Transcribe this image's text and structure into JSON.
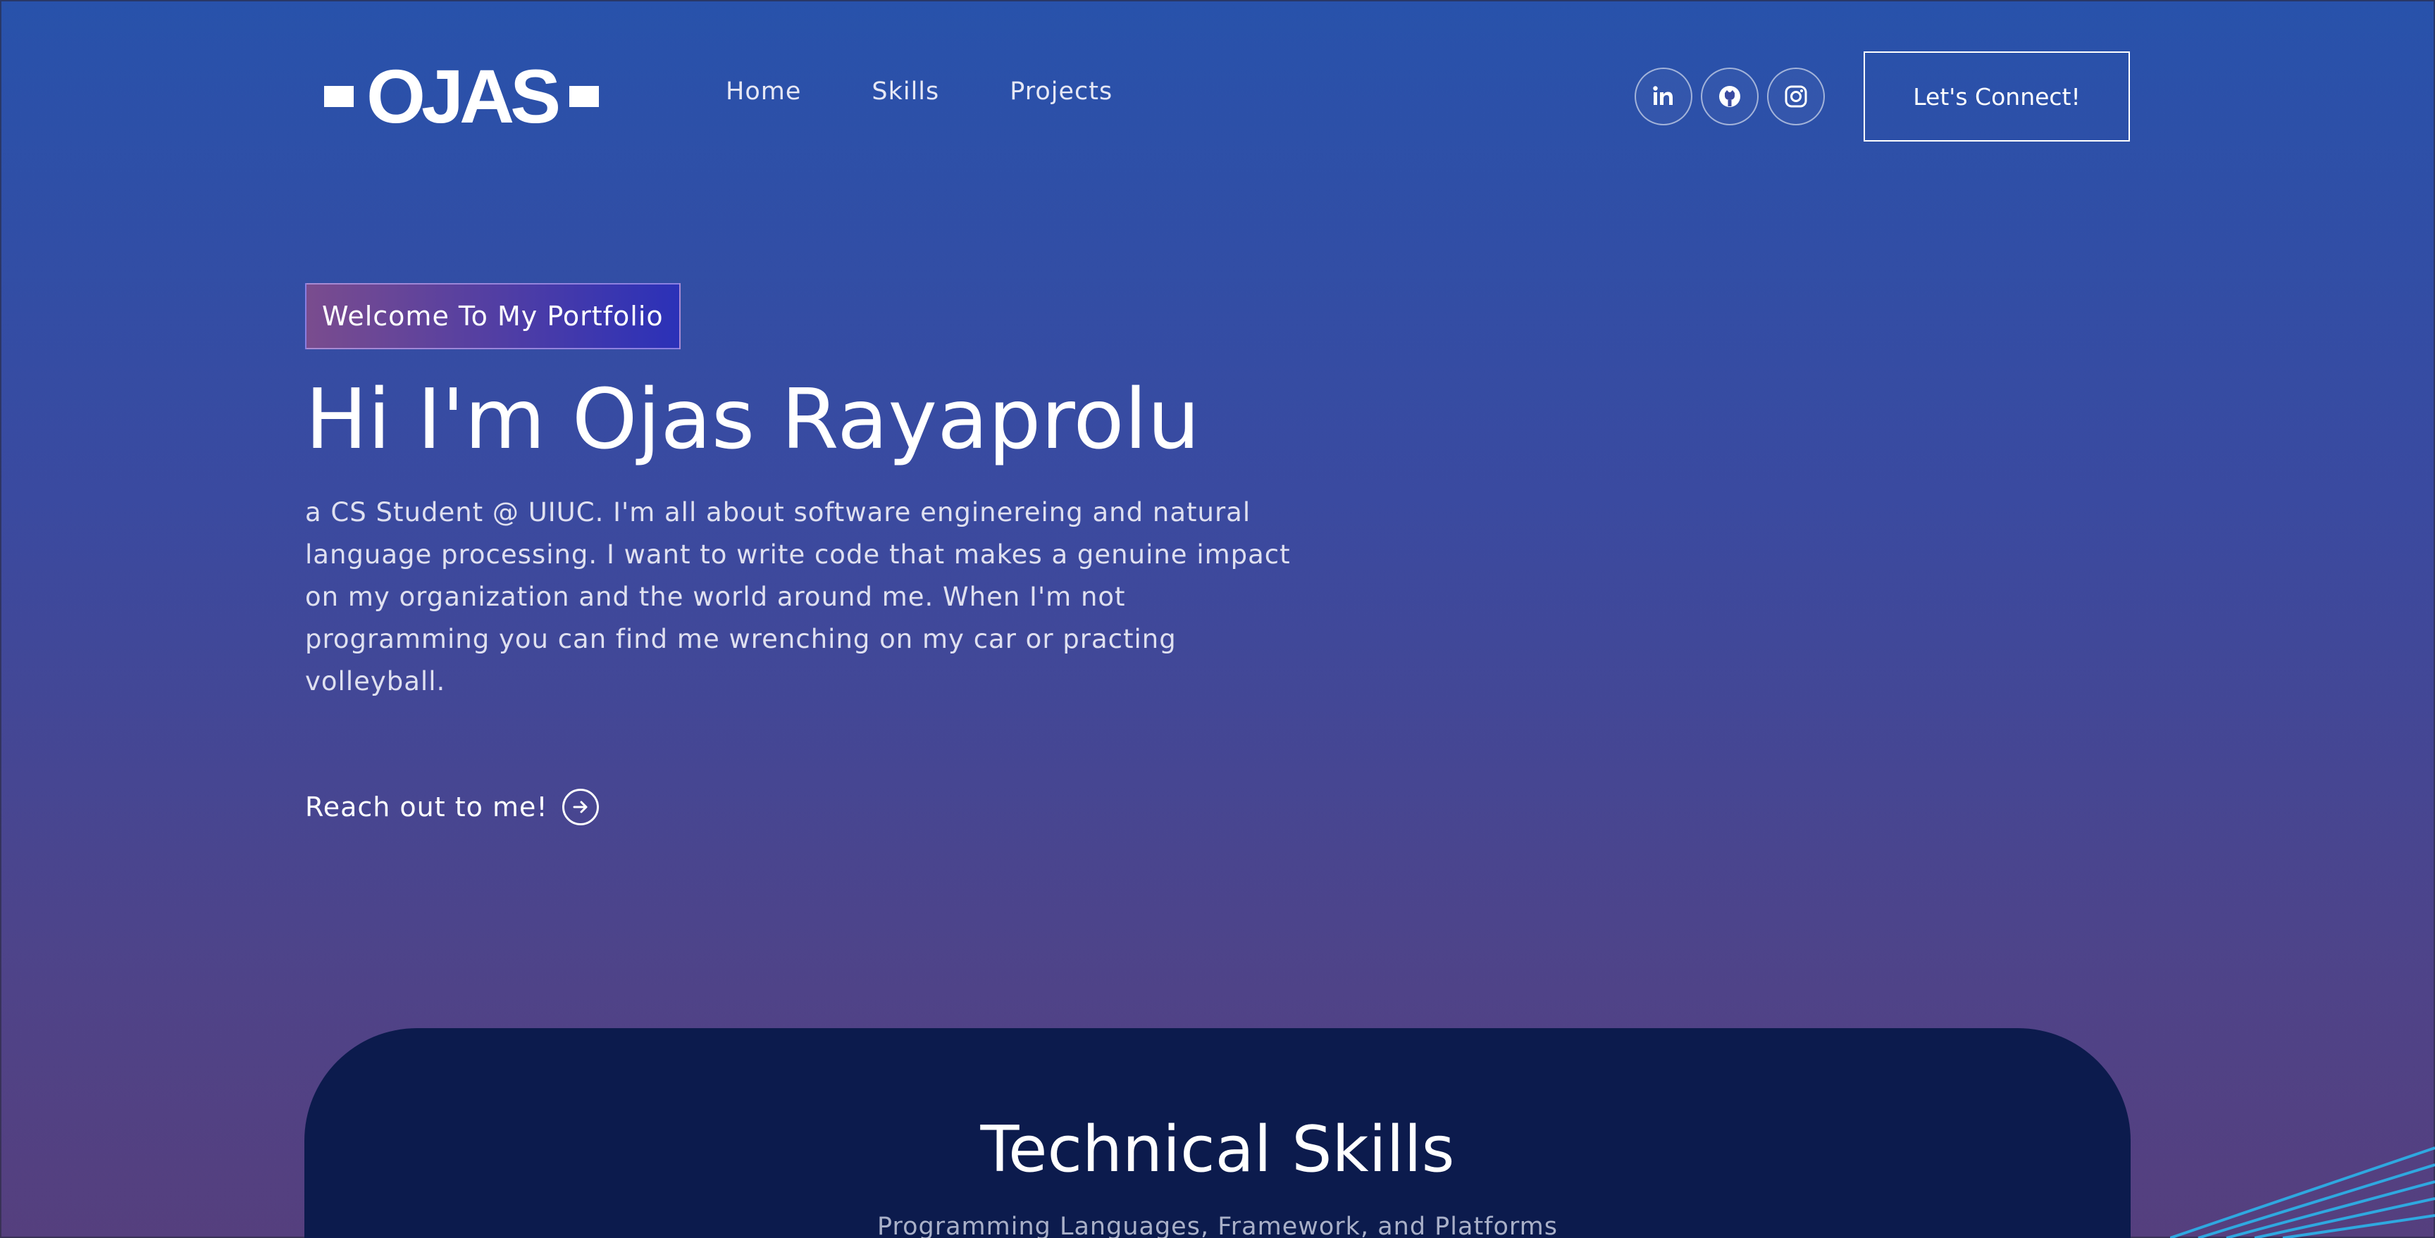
{
  "brand": {
    "logo_text": "OJAS"
  },
  "nav": {
    "links": [
      "Home",
      "Skills",
      "Projects"
    ]
  },
  "social": [
    {
      "name": "linkedin-icon",
      "glyph": "in"
    },
    {
      "name": "github-icon",
      "glyph": "github"
    },
    {
      "name": "instagram-icon",
      "glyph": "instagram"
    }
  ],
  "header": {
    "connect_label": "Let's Connect!"
  },
  "hero": {
    "tagline": "Welcome To My Portfolio",
    "title": "Hi I'm Ojas Rayaprolu",
    "description": "a CS Student @ UIUC. I'm all about software enginereing and natural language processing. I want to write code that makes a genuine impact on my organization and the world around me. When I'm not programming you can find me wrenching on my car or practing volleyball.",
    "cta_label": "Reach out to me!"
  },
  "skills": {
    "title": "Technical Skills",
    "subtitle": "Programming Languages, Framework, and Platforms"
  },
  "colors": {
    "bg_top": "#2852ab",
    "bg_bottom": "#553f7e",
    "card": "#0c1b4d",
    "tagline_left": "#7a4c8e",
    "tagline_right": "#2b31b8",
    "accent_lines": "#2fa8e0"
  }
}
